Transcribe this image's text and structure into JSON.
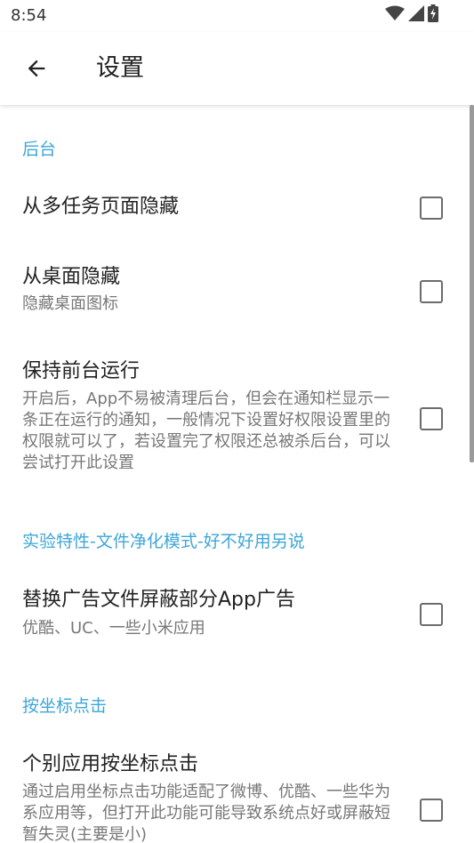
{
  "status_bar": {
    "time": "8:54"
  },
  "app_bar": {
    "title": "设置"
  },
  "sections": [
    {
      "header": "后台",
      "items": [
        {
          "title": "从多任务页面隐藏",
          "summary": "",
          "checked": false
        },
        {
          "title": "从桌面隐藏",
          "summary": "隐藏桌面图标",
          "checked": false
        },
        {
          "title": "保持前台运行",
          "summary": "开启后，App不易被清理后台，但会在通知栏显示一条正在运行的通知，一般情况下设置好权限设置里的权限就可以了，若设置完了权限还总被杀后台，可以尝试打开此设置",
          "checked": false
        }
      ]
    },
    {
      "header": "实验特性-文件净化模式-好不好用另说",
      "items": [
        {
          "title": "替换广告文件屏蔽部分App广告",
          "summary": "优酷、UC、一些小米应用",
          "checked": false
        }
      ]
    },
    {
      "header": "按坐标点击",
      "items": [
        {
          "title": "个别应用按坐标点击",
          "summary": "通过启用坐标点击功能适配了微博、优酷、一些华为系应用等，但打开此功能可能导致系统点好或屏蔽短暂失灵(主要是小)",
          "checked": false
        }
      ]
    }
  ],
  "colors": {
    "accent": "#3ea6d8",
    "title_text": "#222222",
    "summary_text": "#777777",
    "checkbox_border": "#6c6c6c"
  },
  "icons": {
    "back": "arrow-left-icon",
    "wifi": "wifi-icon",
    "signal": "cell-signal-icon",
    "battery": "battery-charging-icon"
  }
}
